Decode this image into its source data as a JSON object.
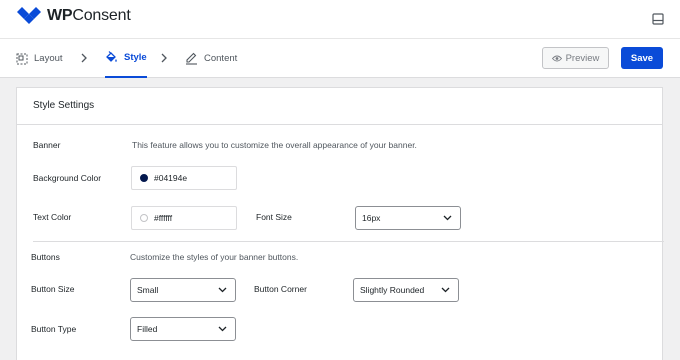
{
  "app": {
    "brand_bold": "WP",
    "brand_rest": "Consent"
  },
  "steps": [
    {
      "label": "Layout",
      "icon": "layout-icon",
      "active": false
    },
    {
      "label": "Style",
      "icon": "paint-bucket-icon",
      "active": true
    },
    {
      "label": "Content",
      "icon": "pencil-icon",
      "active": false
    }
  ],
  "actions": {
    "preview_label": "Preview",
    "save_label": "Save"
  },
  "settings": {
    "title": "Style Settings",
    "banner": {
      "label": "Banner",
      "description": "This feature allows you to customize the overall appearance of your banner.",
      "background_color": {
        "label": "Background Color",
        "value": "#04194e",
        "swatch": "#04194e"
      },
      "text_color": {
        "label": "Text Color",
        "value": "#ffffff",
        "swatch": "#ffffff"
      },
      "font_size": {
        "label": "Font Size",
        "value": "16px"
      }
    },
    "buttons": {
      "label": "Buttons",
      "description": "Customize the styles of your banner buttons.",
      "button_size": {
        "label": "Button Size",
        "value": "Small"
      },
      "button_corner": {
        "label": "Button Corner",
        "value": "Slightly Rounded"
      },
      "button_type": {
        "label": "Button Type",
        "value": "Filled"
      }
    }
  },
  "colors": {
    "accent": "#0a4bd8",
    "border": "#dcdcde"
  }
}
